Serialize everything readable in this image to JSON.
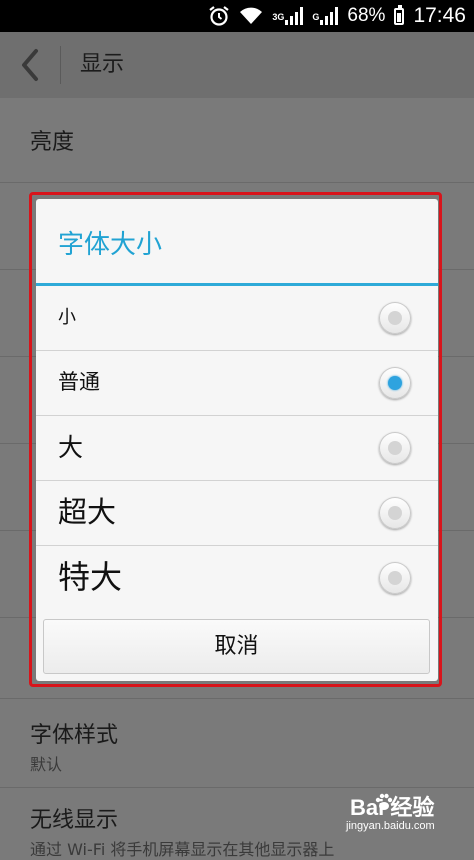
{
  "status_bar": {
    "network_3g": "3G",
    "network_g": "G",
    "battery": "68%",
    "time": "17:46",
    "icons": [
      "alarm-icon",
      "wifi-icon",
      "signal-icon",
      "signal-icon",
      "battery-icon"
    ]
  },
  "header": {
    "title": "显示",
    "back_icon": "chevron-left-icon"
  },
  "settings": {
    "brightness": "亮度",
    "font_style": {
      "label": "字体样式",
      "value": "默认"
    },
    "wireless_display": {
      "label": "无线显示",
      "description": "通过 Wi-Fi 将手机屏幕显示在其他显示器上"
    }
  },
  "dialog": {
    "title": "字体大小",
    "options": [
      {
        "label": "小",
        "checked": false
      },
      {
        "label": "普通",
        "checked": true
      },
      {
        "label": "大",
        "checked": false
      },
      {
        "label": "超大",
        "checked": false
      },
      {
        "label": "特大",
        "checked": false
      }
    ],
    "cancel_label": "取消"
  },
  "watermark": {
    "brand": "Bai 经验",
    "url": "jingyan.baidu.com"
  },
  "colors": {
    "accent": "#2eaad8",
    "highlight_border": "#d8141b",
    "dim_overlay": "#7a7a7a"
  }
}
